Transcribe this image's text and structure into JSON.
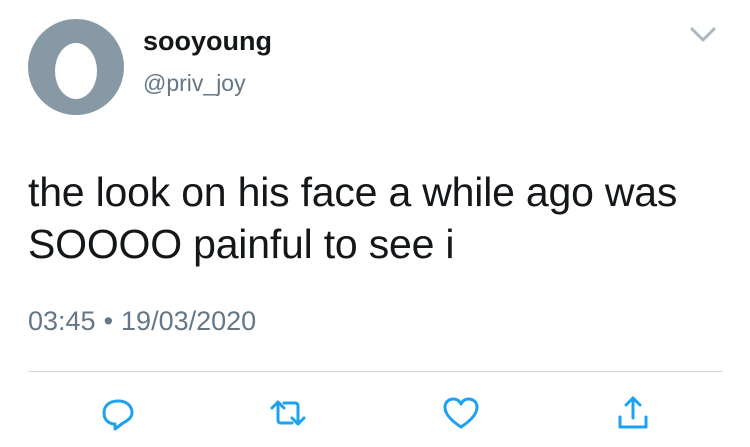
{
  "user": {
    "display_name": "sooyoung",
    "handle": "@priv_joy",
    "avatar_icon": "default-egg-avatar"
  },
  "tweet": {
    "text_lines": [
      "the look on his face a while ago was",
      "SOOOO painful to see i"
    ],
    "time": "03:45",
    "separator": "•",
    "date": "19/03/2020"
  },
  "actions": {
    "reply_icon": "reply-icon",
    "retweet_icon": "retweet-icon",
    "like_icon": "heart-icon",
    "share_icon": "share-icon"
  },
  "colors": {
    "text": "#14171a",
    "secondary": "#657786",
    "avatar_bg": "#8899a6",
    "action_icon": "#1da1f2",
    "divider": "#ccd6dd"
  }
}
